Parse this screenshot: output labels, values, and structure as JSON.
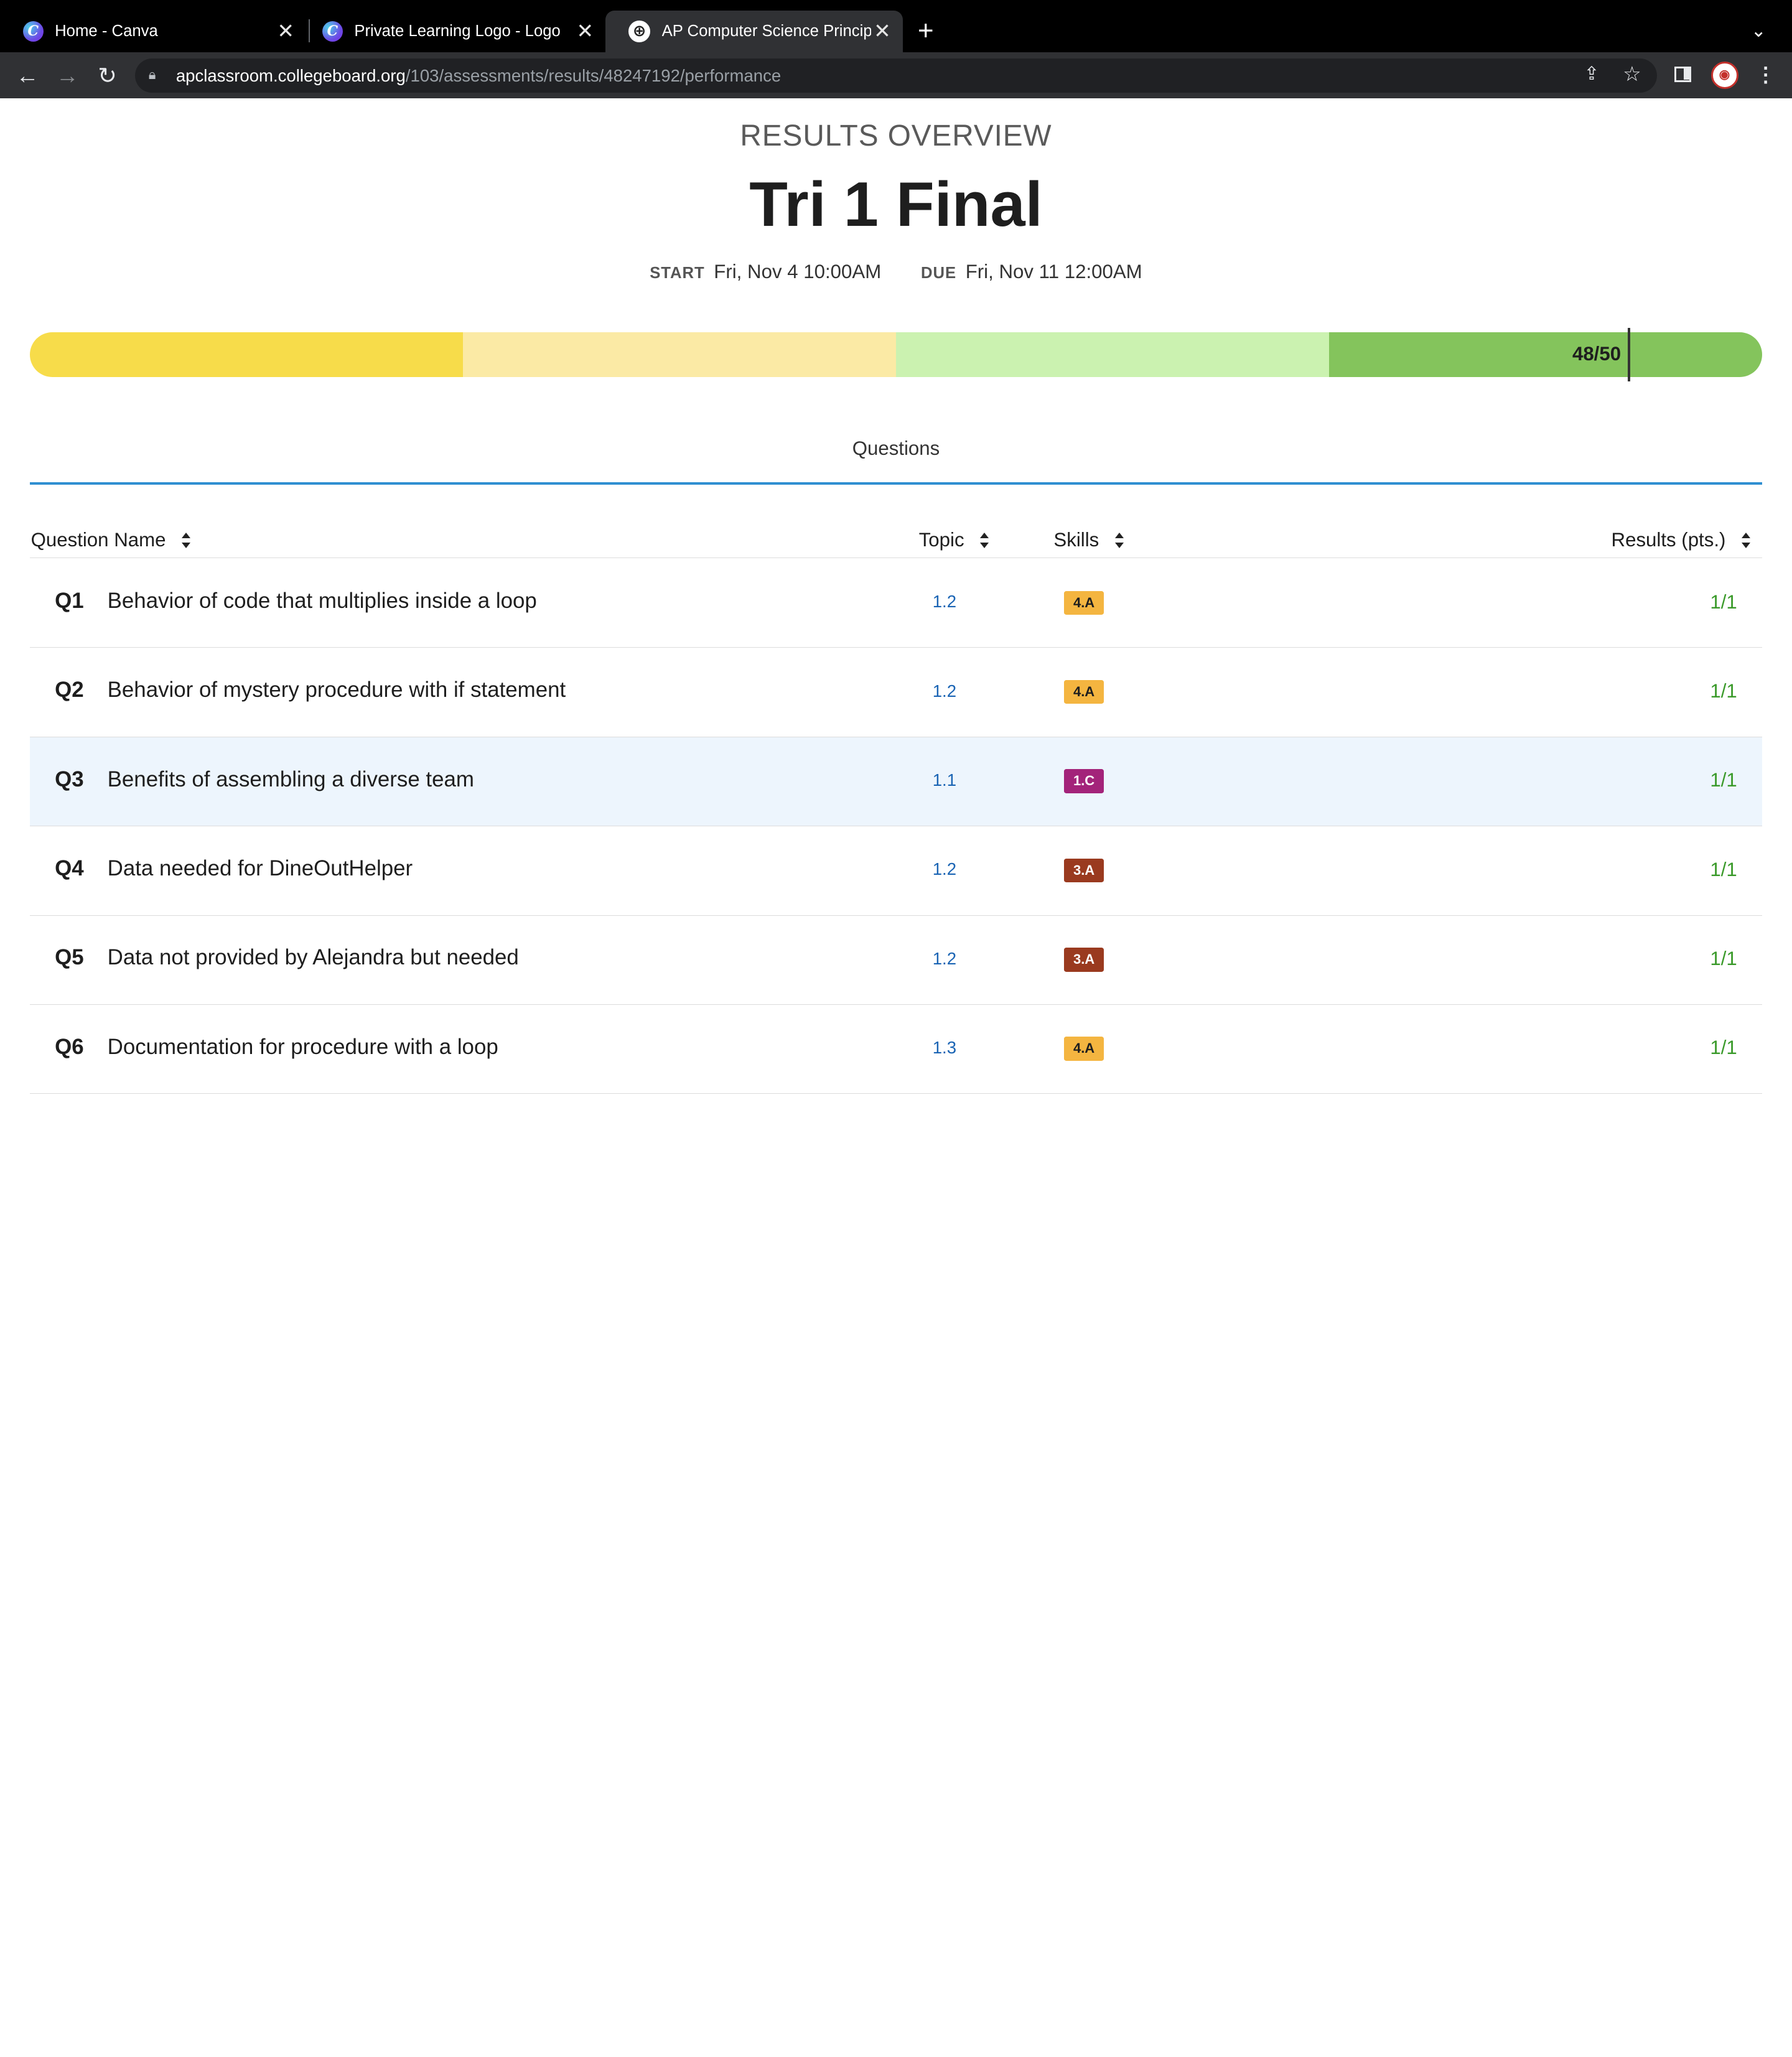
{
  "browser": {
    "tabs": [
      {
        "title": "Home - Canva",
        "icon": "canva-icon",
        "active": false
      },
      {
        "title": "Private Learning Logo - Logo",
        "icon": "canva-icon",
        "active": false
      },
      {
        "title": "AP Computer Science Principles",
        "icon": "globe-icon",
        "active": true
      }
    ],
    "url_host": "apclassroom.collegeboard.org",
    "url_path": "/103/assessments/results/48247192/performance"
  },
  "page": {
    "overline": "RESULTS OVERVIEW",
    "title": "Tri 1 Final",
    "start_label": "START",
    "start_value": "Fri, Nov 4 10:00AM",
    "due_label": "DUE",
    "due_value": "Fri, Nov 11 12:00AM"
  },
  "score": {
    "text": "48/50",
    "earned": 48,
    "possible": 50,
    "band_colors": [
      "#f7dc4a",
      "#fbeaa5",
      "#cbf2b0",
      "#84c45c"
    ]
  },
  "tabs": {
    "questions_label": "Questions"
  },
  "table": {
    "headers": {
      "question_name": "Question Name",
      "topic": "Topic",
      "skills": "Skills",
      "results": "Results (pts.)"
    },
    "rows": [
      {
        "num": "Q1",
        "name": "Behavior of code that multiplies inside a loop",
        "topic": "1.2",
        "skill": "4.A",
        "skill_color": "#f4b540",
        "skill_text_color": "#1e1e1e",
        "result": "1/1"
      },
      {
        "num": "Q2",
        "name": "Behavior of mystery procedure with if statement",
        "topic": "1.2",
        "skill": "4.A",
        "skill_color": "#f4b540",
        "skill_text_color": "#1e1e1e",
        "result": "1/1"
      },
      {
        "num": "Q3",
        "name": "Benefits of assembling a diverse team",
        "topic": "1.1",
        "skill": "1.C",
        "skill_color": "#a3237a",
        "skill_text_color": "#ffffff",
        "result": "1/1",
        "highlighted": true
      },
      {
        "num": "Q4",
        "name": "Data needed for DineOutHelper",
        "topic": "1.2",
        "skill": "3.A",
        "skill_color": "#9a3a1f",
        "skill_text_color": "#ffffff",
        "result": "1/1"
      },
      {
        "num": "Q5",
        "name": "Data not provided by Alejandra but needed",
        "topic": "1.2",
        "skill": "3.A",
        "skill_color": "#9a3a1f",
        "skill_text_color": "#ffffff",
        "result": "1/1"
      },
      {
        "num": "Q6",
        "name": "Documentation for procedure with a loop",
        "topic": "1.3",
        "skill": "4.A",
        "skill_color": "#f4b540",
        "skill_text_color": "#1e1e1e",
        "result": "1/1"
      }
    ]
  }
}
